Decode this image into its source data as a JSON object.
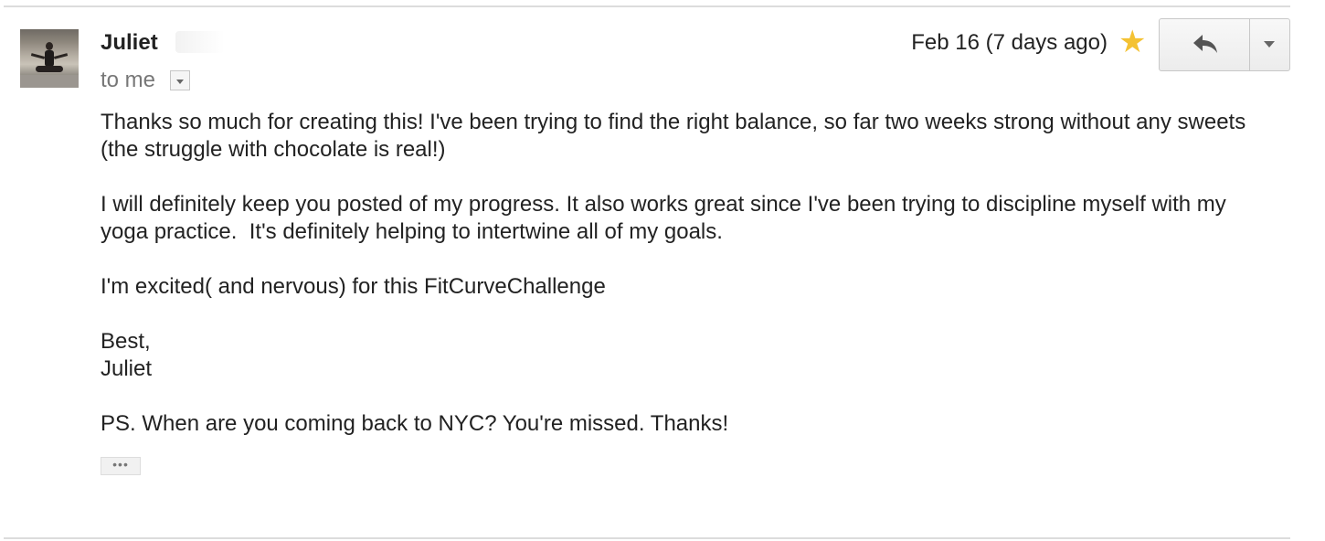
{
  "message": {
    "sender": "Juliet",
    "recipient": "to me",
    "date": "Feb 16 (7 days ago)",
    "starred": true,
    "body": [
      "Thanks so much for creating this! I've been trying to find the right balance, so far two weeks strong without any sweets (the struggle with chocolate is real!)",
      "I will definitely keep you posted of my progress. It also works great since I've been trying to discipline myself with my yoga practice.  It's definitely helping to intertwine all of my goals.",
      "I'm excited( and nervous) for this FitCurveChallenge",
      "Best,\nJuliet",
      "PS. When are you coming back to NYC? You're missed. Thanks!"
    ],
    "trimmed_content_label": "•••"
  },
  "icons": {
    "avatar": "avatar-photo",
    "star": "star-icon",
    "reply": "reply-arrow-icon",
    "more": "chevron-down-icon",
    "details": "details-dropdown-icon"
  },
  "colors": {
    "star": "#f4c233",
    "text": "#222222",
    "muted": "#777777"
  }
}
